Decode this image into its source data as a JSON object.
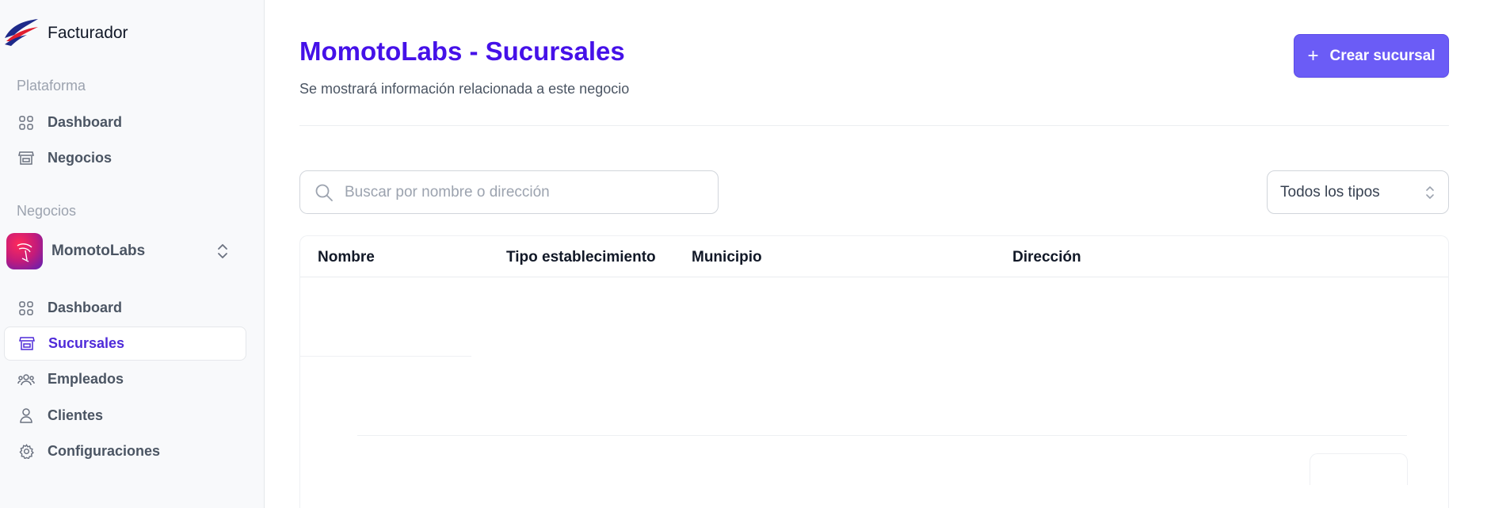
{
  "app": {
    "name": "Facturador"
  },
  "sidebar": {
    "platform_label": "Plataforma",
    "platform_items": [
      {
        "label": "Dashboard",
        "icon": "grid-icon"
      },
      {
        "label": "Negocios",
        "icon": "store-icon"
      }
    ],
    "business_label": "Negocios",
    "business": {
      "name": "MomotoLabs"
    },
    "business_items": [
      {
        "label": "Dashboard",
        "icon": "grid-icon",
        "active": false
      },
      {
        "label": "Sucursales",
        "icon": "store-icon",
        "active": true
      },
      {
        "label": "Empleados",
        "icon": "users-icon",
        "active": false
      },
      {
        "label": "Clientes",
        "icon": "user-icon",
        "active": false
      },
      {
        "label": "Configuraciones",
        "icon": "gear-icon",
        "active": false
      }
    ]
  },
  "header": {
    "title": "MomotoLabs - Sucursales",
    "subtitle": "Se mostrará información relacionada a este negocio",
    "create_button": "Crear sucursal"
  },
  "filters": {
    "search_placeholder": "Buscar por nombre o dirección",
    "search_value": "",
    "type_select": "Todos los tipos"
  },
  "table": {
    "columns": [
      "Nombre",
      "Tipo establecimiento",
      "Municipio",
      "Dirección"
    ],
    "rows": []
  },
  "colors": {
    "accent": "#4511e8",
    "button": "#6b5cf6",
    "active_nav": "#4f2bd9",
    "sidebar_bg": "#f8f9fb"
  }
}
